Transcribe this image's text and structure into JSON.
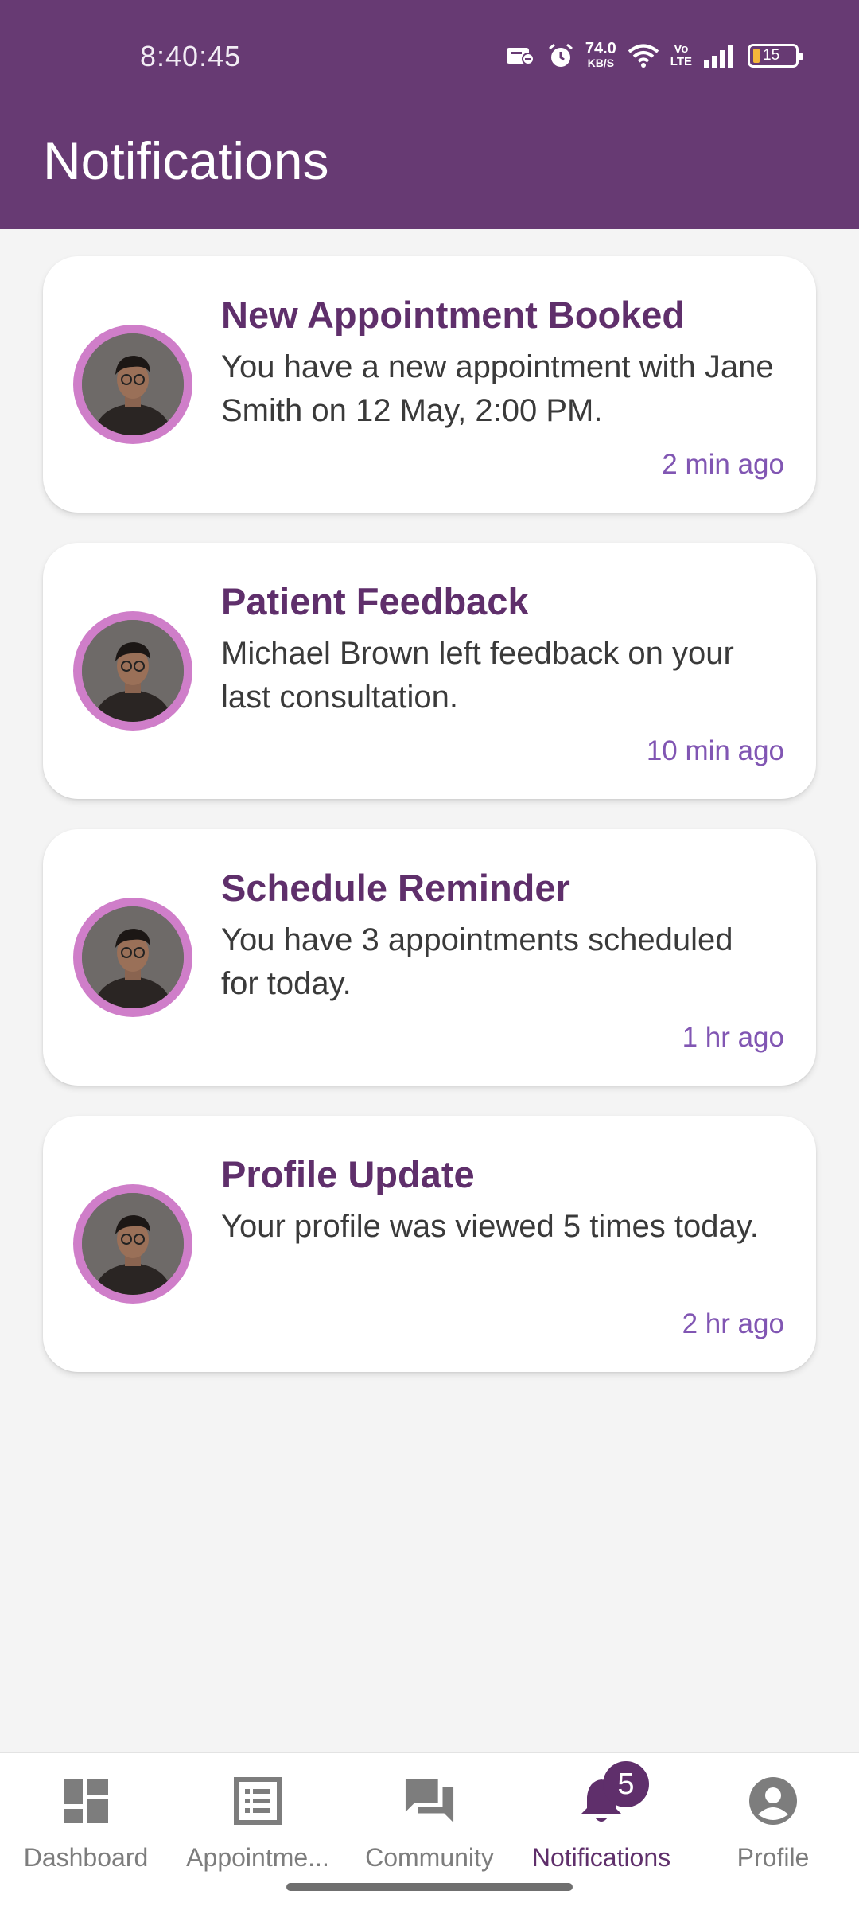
{
  "status_bar": {
    "time": "8:40:45",
    "net_speed_value": "74.0",
    "net_speed_unit": "KB/S",
    "volte_top": "Vo",
    "volte_bottom": "LTE",
    "battery": "15"
  },
  "header": {
    "title": "Notifications"
  },
  "notifications": [
    {
      "title": "New Appointment Booked",
      "message": "You have a new appointment with Jane Smith on 12 May, 2:00 PM.",
      "time": "2 min ago"
    },
    {
      "title": "Patient Feedback",
      "message": "Michael Brown left feedback on your last consultation.",
      "time": "10 min ago"
    },
    {
      "title": "Schedule Reminder",
      "message": "You have 3 appointments scheduled for today.",
      "time": "1 hr ago"
    },
    {
      "title": "Profile Update",
      "message": "Your profile was viewed 5 times today.",
      "time": "2 hr ago"
    }
  ],
  "bottom_nav": {
    "items": [
      {
        "label": "Dashboard",
        "icon": "dashboard-icon"
      },
      {
        "label": "Appointme...",
        "icon": "list-icon"
      },
      {
        "label": "Community",
        "icon": "chat-icon"
      },
      {
        "label": "Notifications",
        "icon": "bell-icon",
        "badge": "5",
        "active": true
      },
      {
        "label": "Profile",
        "icon": "account-circle-icon"
      }
    ]
  },
  "colors": {
    "primary": "#673a73",
    "title_text": "#5f2f6b",
    "time_text": "#8156b3",
    "avatar_ring": "#cf7ec9"
  }
}
